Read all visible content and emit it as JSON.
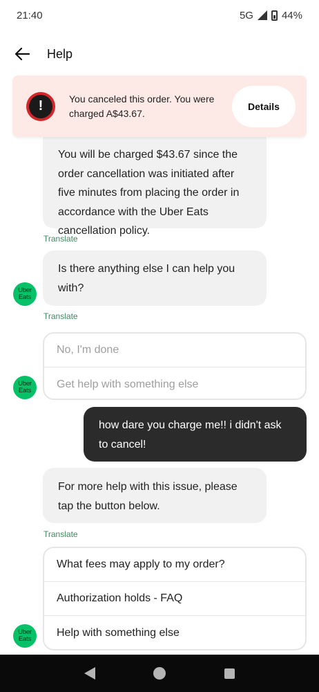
{
  "status_bar": {
    "time": "21:40",
    "network": "5G",
    "battery": "44%"
  },
  "header": {
    "title": "Help",
    "back_icon": "arrow-left-icon"
  },
  "banner": {
    "message": "You canceled this order. You were charged A$43.67.",
    "details_label": "Details",
    "icon": "exclamation-icon",
    "colors": {
      "background": "#fde9e6",
      "icon_ring": "#d2262a"
    }
  },
  "chat": {
    "message_1": "You will be charged $43.67 since the order cancellation was initiated after five minutes from placing the order in accordance with the Uber Eats cancellation policy.",
    "translate_label": "Translate",
    "message_2": "Is there anything else I can help you with?",
    "avatar_line_1": "Uber",
    "avatar_line_2": "Eats",
    "options_1": [
      "No, I'm done",
      "Get help with something else"
    ],
    "user_message": "how dare you charge me!! i didn't ask to cancel!",
    "message_3": "For more help with this issue, please tap the button below.",
    "options_2": [
      "What fees may apply to my order?",
      "Authorization holds - FAQ",
      "Help with something else"
    ]
  },
  "colors": {
    "brand_green": "#06c167",
    "translate_green": "#3d8a5f",
    "user_bubble": "#2b2b2b"
  }
}
